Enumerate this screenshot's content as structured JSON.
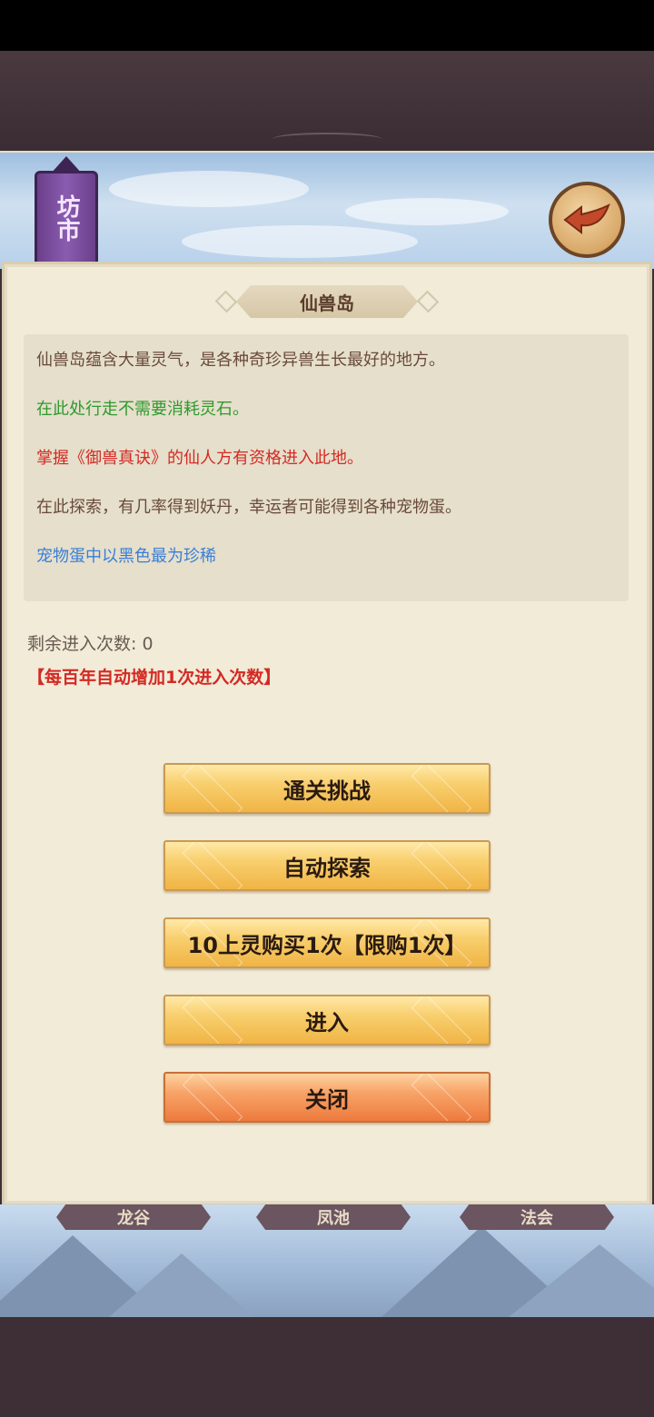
{
  "header": {
    "banner_text": "坊市",
    "back_icon": "back-arrow-icon"
  },
  "dialog": {
    "title": "仙兽岛",
    "description": [
      {
        "text": "仙兽岛蕴含大量灵气，是各种奇珍异兽生长最好的地方。",
        "color": "#6a4a3a"
      },
      {
        "text": "在此处行走不需要消耗灵石。",
        "color": "#2e9a2e"
      },
      {
        "text": "掌握《御兽真诀》的仙人方有资格进入此地。",
        "color": "#d42a24"
      },
      {
        "text": "在此探索，有几率得到妖丹，幸运者可能得到各种宠物蛋。",
        "color": "#6a4a3a"
      },
      {
        "text": "宠物蛋中以黑色最为珍稀",
        "color": "#3a7ed8"
      }
    ],
    "remaining_label": "剩余进入次数:",
    "remaining_value": "0",
    "auto_note": "【每百年自动增加1次进入次数】",
    "buttons": {
      "challenge": "通关挑战",
      "auto_explore": "自动探索",
      "buy": "10上灵购买1次【限购1次】",
      "enter": "进入",
      "close": "关闭"
    }
  },
  "bottom_tabs": [
    "龙谷",
    "凤池",
    "法会"
  ]
}
